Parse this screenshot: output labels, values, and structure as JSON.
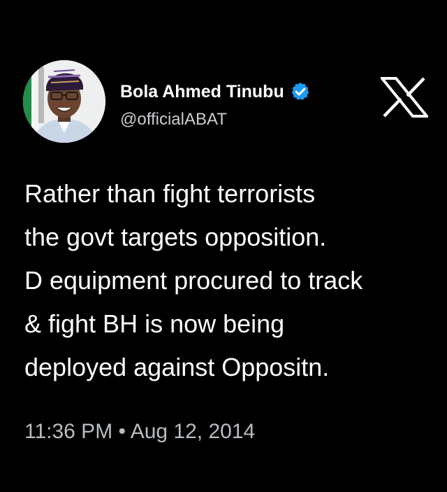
{
  "tweet": {
    "author": {
      "display_name": "Bola Ahmed Tinubu",
      "handle": "@officialABAT",
      "verified": true,
      "verified_badge_icon": "verified-check-badge",
      "verified_color": "#1d9bf0",
      "avatar_icon": "profile-photo"
    },
    "platform_logo_icon": "x-logo",
    "body_lines": [
      "Rather than fight terrorists",
      "the govt targets opposition.",
      "D equipment procured to track",
      "& fight BH is now being",
      "deployed against Oppositn."
    ],
    "timestamp": "11:36 PM • Aug 12, 2014"
  },
  "colors": {
    "background": "#000000",
    "primary_text": "#ffffff",
    "secondary_text": "#c9cdd1"
  }
}
